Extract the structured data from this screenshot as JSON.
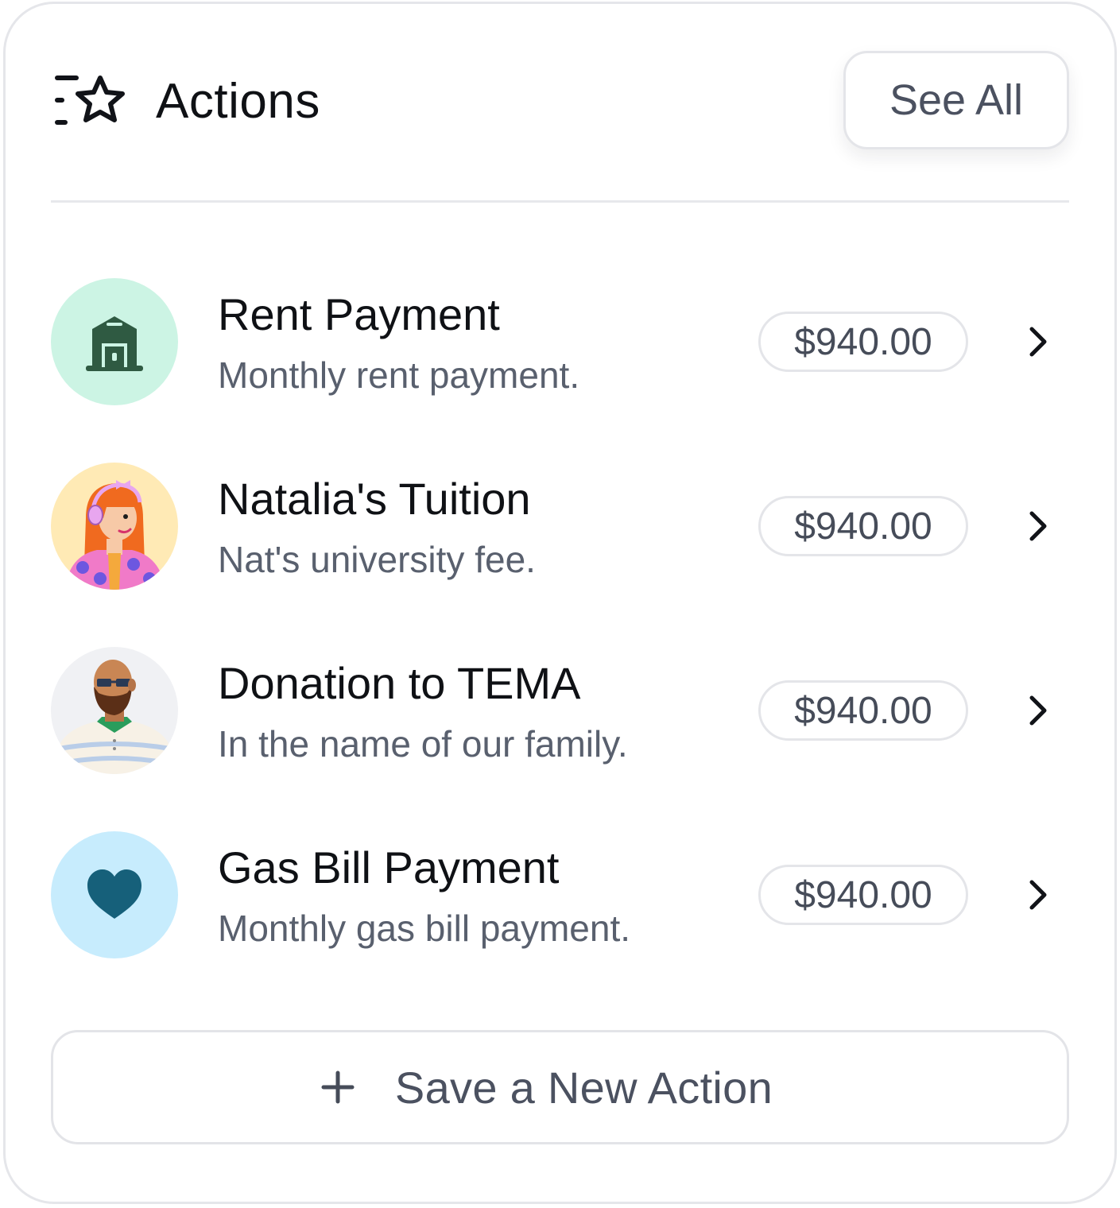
{
  "header": {
    "title": "Actions",
    "icon": "star-list-icon",
    "see_all_label": "See All"
  },
  "actions": [
    {
      "title": "Rent Payment",
      "subtitle": "Monthly rent payment.",
      "amount": "$940.00",
      "avatar": "house-icon",
      "avatar_bg": "#ccf4e4"
    },
    {
      "title": "Natalia's Tuition",
      "subtitle": "Nat's university fee.",
      "amount": "$940.00",
      "avatar": "woman-with-headphones-avatar",
      "avatar_bg": "#ffeab5"
    },
    {
      "title": "Donation to TEMA",
      "subtitle": "In the name of our family.",
      "amount": "$940.00",
      "avatar": "bearded-man-avatar",
      "avatar_bg": "#f0f1f4"
    },
    {
      "title": "Gas Bill Payment",
      "subtitle": "Monthly gas bill payment.",
      "amount": "$940.00",
      "avatar": "heart-icon",
      "avatar_bg": "#c7ecfd"
    }
  ],
  "footer": {
    "save_label": "Save a New Action",
    "icon": "plus-icon"
  },
  "colors": {
    "border": "#e4e5e9",
    "text_primary": "#0f1115",
    "text_secondary": "#59606e",
    "house_icon": "#2f5a42",
    "heart_icon": "#16607a"
  }
}
